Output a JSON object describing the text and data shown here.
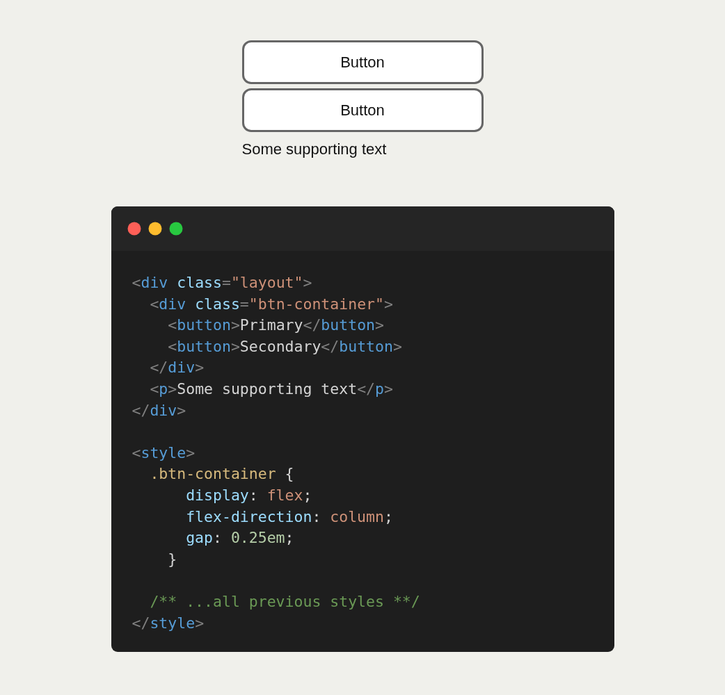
{
  "buttons": [
    {
      "label": "Button"
    },
    {
      "label": "Button"
    }
  ],
  "supporting_text": "Some supporting text",
  "code_window": {
    "lines": [
      {
        "kind": "code",
        "tokens": [
          {
            "kind": "punct",
            "text": "<"
          },
          {
            "kind": "tag",
            "text": "div"
          },
          {
            "kind": "attr",
            "text": " class"
          },
          {
            "kind": "punct",
            "text": "="
          },
          {
            "kind": "string",
            "text": "\"layout\""
          },
          {
            "kind": "punct",
            "text": ">"
          }
        ]
      },
      {
        "kind": "code",
        "tokens": [
          {
            "kind": "punct",
            "text": "  <"
          },
          {
            "kind": "tag",
            "text": "div"
          },
          {
            "kind": "attr",
            "text": " class"
          },
          {
            "kind": "punct",
            "text": "="
          },
          {
            "kind": "string",
            "text": "\"btn-container\""
          },
          {
            "kind": "punct",
            "text": ">"
          }
        ]
      },
      {
        "kind": "code",
        "tokens": [
          {
            "kind": "punct",
            "text": "    <"
          },
          {
            "kind": "tag",
            "text": "button"
          },
          {
            "kind": "punct",
            "text": ">"
          },
          {
            "kind": "text",
            "text": "Primary"
          },
          {
            "kind": "punct",
            "text": "</"
          },
          {
            "kind": "tag",
            "text": "button"
          },
          {
            "kind": "punct",
            "text": ">"
          }
        ]
      },
      {
        "kind": "code",
        "tokens": [
          {
            "kind": "punct",
            "text": "    <"
          },
          {
            "kind": "tag",
            "text": "button"
          },
          {
            "kind": "punct",
            "text": ">"
          },
          {
            "kind": "text",
            "text": "Secondary"
          },
          {
            "kind": "punct",
            "text": "</"
          },
          {
            "kind": "tag",
            "text": "button"
          },
          {
            "kind": "punct",
            "text": ">"
          }
        ]
      },
      {
        "kind": "code",
        "tokens": [
          {
            "kind": "punct",
            "text": "  </"
          },
          {
            "kind": "tag",
            "text": "div"
          },
          {
            "kind": "punct",
            "text": ">"
          }
        ]
      },
      {
        "kind": "code",
        "tokens": [
          {
            "kind": "punct",
            "text": "  <"
          },
          {
            "kind": "tag",
            "text": "p"
          },
          {
            "kind": "punct",
            "text": ">"
          },
          {
            "kind": "text",
            "text": "Some supporting text"
          },
          {
            "kind": "punct",
            "text": "</"
          },
          {
            "kind": "tag",
            "text": "p"
          },
          {
            "kind": "punct",
            "text": ">"
          }
        ]
      },
      {
        "kind": "code",
        "tokens": [
          {
            "kind": "punct",
            "text": "</"
          },
          {
            "kind": "tag",
            "text": "div"
          },
          {
            "kind": "punct",
            "text": ">"
          }
        ]
      },
      {
        "kind": "blank"
      },
      {
        "kind": "code",
        "tokens": [
          {
            "kind": "punct",
            "text": "<"
          },
          {
            "kind": "tag",
            "text": "style"
          },
          {
            "kind": "punct",
            "text": ">"
          }
        ]
      },
      {
        "kind": "code",
        "tokens": [
          {
            "kind": "selector",
            "text": "  .btn-container"
          },
          {
            "kind": "text",
            "text": " {"
          }
        ]
      },
      {
        "kind": "code",
        "tokens": [
          {
            "kind": "prop",
            "text": "      display"
          },
          {
            "kind": "text",
            "text": ": "
          },
          {
            "kind": "value",
            "text": "flex"
          },
          {
            "kind": "text",
            "text": ";"
          }
        ]
      },
      {
        "kind": "code",
        "tokens": [
          {
            "kind": "prop",
            "text": "      flex-direction"
          },
          {
            "kind": "text",
            "text": ": "
          },
          {
            "kind": "value",
            "text": "column"
          },
          {
            "kind": "text",
            "text": ";"
          }
        ]
      },
      {
        "kind": "code",
        "tokens": [
          {
            "kind": "prop",
            "text": "      gap"
          },
          {
            "kind": "text",
            "text": ": "
          },
          {
            "kind": "number",
            "text": "0.25em"
          },
          {
            "kind": "text",
            "text": ";"
          }
        ]
      },
      {
        "kind": "code",
        "tokens": [
          {
            "kind": "text",
            "text": "    }"
          }
        ]
      },
      {
        "kind": "blank"
      },
      {
        "kind": "code",
        "tokens": [
          {
            "kind": "comment",
            "text": "  /** ...all previous styles **/"
          }
        ]
      },
      {
        "kind": "code",
        "tokens": [
          {
            "kind": "punct",
            "text": "</"
          },
          {
            "kind": "tag",
            "text": "style"
          },
          {
            "kind": "punct",
            "text": ">"
          }
        ]
      }
    ]
  }
}
